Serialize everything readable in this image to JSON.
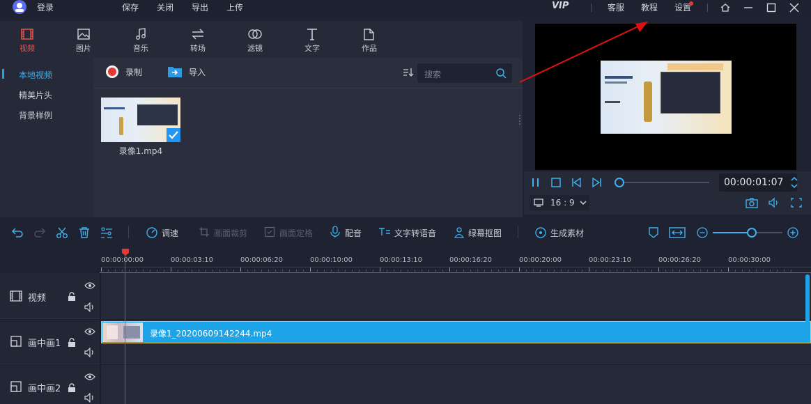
{
  "titlebar": {
    "login": "登录",
    "menu": [
      "保存",
      "关闭",
      "导出",
      "上传"
    ],
    "vip": "VIP",
    "right_links": [
      "客服",
      "教程",
      "设置"
    ]
  },
  "media_tabs": [
    {
      "label": "视频",
      "icon": "film-icon",
      "active": true
    },
    {
      "label": "图片",
      "icon": "image-icon"
    },
    {
      "label": "音乐",
      "icon": "music-icon"
    },
    {
      "label": "转场",
      "icon": "transition-icon"
    },
    {
      "label": "滤镜",
      "icon": "filter-icon"
    },
    {
      "label": "文字",
      "icon": "text-icon"
    },
    {
      "label": "作品",
      "icon": "folder-icon"
    }
  ],
  "sidebar": {
    "items": [
      "本地视频",
      "精美片头",
      "背景样例"
    ]
  },
  "content": {
    "record_label": "录制",
    "import_label": "导入",
    "search_placeholder": "搜索",
    "file_name": "录像1.mp4"
  },
  "preview": {
    "timecode": "00:00:01:07",
    "aspect": "16 : 9"
  },
  "toolbar": {
    "speed": "调速",
    "crop": "画面裁剪",
    "freeze": "画面定格",
    "dub": "配音",
    "tts": "文字转语音",
    "green": "绿幕抠图",
    "generate": "生成素材"
  },
  "ruler": [
    "00:00:00:00",
    "00:00:03:10",
    "00:00:06:20",
    "00:00:10:00",
    "00:00:13:10",
    "00:00:16:20",
    "00:00:20:00",
    "00:00:23:10",
    "00:00:26:20",
    "00:00:30:00"
  ],
  "tracks": [
    {
      "name": "视频"
    },
    {
      "name": "画中画1",
      "clip": "录像1_20200609142244.mp4"
    },
    {
      "name": "画中画2"
    }
  ],
  "colors": {
    "accent_red": "#e5534b",
    "clip_blue": "#1da3e8",
    "playhead": "#e53935"
  }
}
